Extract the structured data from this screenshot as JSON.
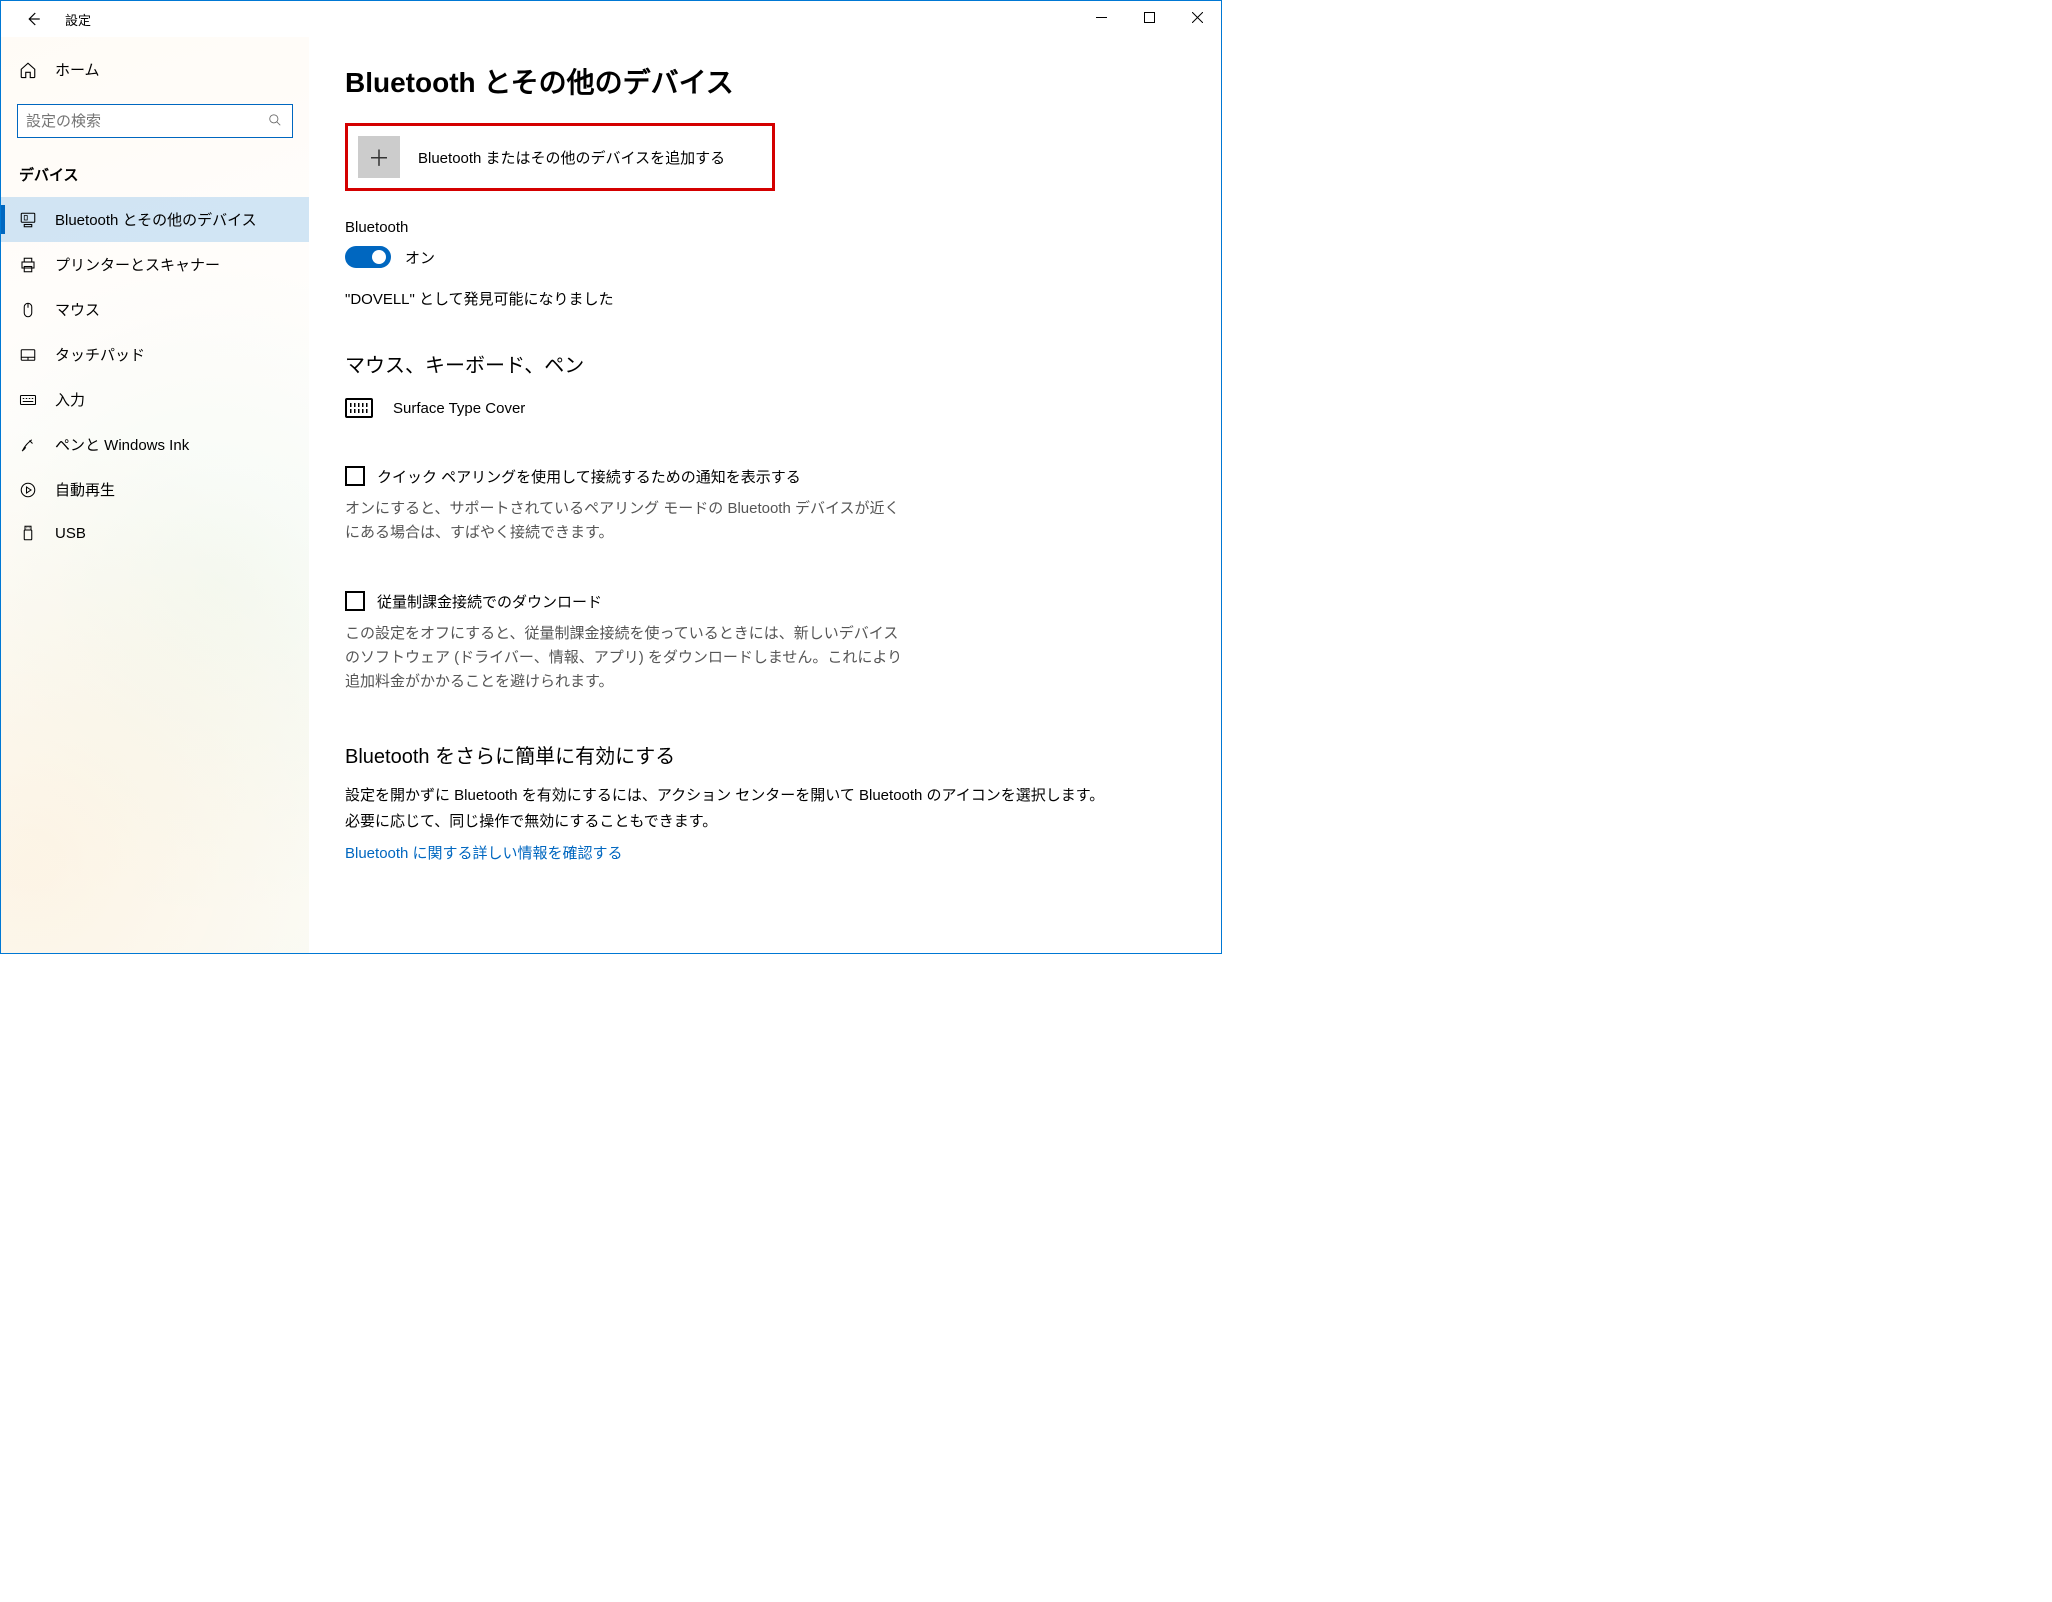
{
  "window": {
    "title": "設定"
  },
  "sidebar": {
    "home": "ホーム",
    "searchPlaceholder": "設定の検索",
    "category": "デバイス",
    "items": [
      {
        "label": "Bluetooth とその他のデバイス",
        "icon": "device-icon",
        "active": true
      },
      {
        "label": "プリンターとスキャナー",
        "icon": "printer-icon",
        "active": false
      },
      {
        "label": "マウス",
        "icon": "mouse-icon",
        "active": false
      },
      {
        "label": "タッチパッド",
        "icon": "touchpad-icon",
        "active": false
      },
      {
        "label": "入力",
        "icon": "keyboard-icon",
        "active": false
      },
      {
        "label": "ペンと Windows Ink",
        "icon": "pen-icon",
        "active": false
      },
      {
        "label": "自動再生",
        "icon": "autoplay-icon",
        "active": false
      },
      {
        "label": "USB",
        "icon": "usb-icon",
        "active": false
      }
    ]
  },
  "main": {
    "title": "Bluetooth とその他のデバイス",
    "addDevice": "Bluetooth またはその他のデバイスを追加する",
    "bluetoothLabel": "Bluetooth",
    "toggleState": "オン",
    "discoverable": "\"DOVELL\" として発見可能になりました",
    "groupTitle": "マウス、キーボード、ペン",
    "device0": "Surface Type Cover",
    "quickPair": {
      "checkLabel": "クイック ペアリングを使用して接続するための通知を表示する",
      "desc": "オンにすると、サポートされているペアリング モードの Bluetooth デバイスが近くにある場合は、すばやく接続できます。"
    },
    "metered": {
      "checkLabel": "従量制課金接続でのダウンロード",
      "desc": "この設定をオフにすると、従量制課金接続を使っているときには、新しいデバイスのソフトウェア (ドライバー、情報、アプリ) をダウンロードしません。これにより追加料金がかかることを避けられます。"
    },
    "more": {
      "title": "Bluetooth をさらに簡単に有効にする",
      "desc": "設定を開かずに Bluetooth を有効にするには、アクション センターを開いて Bluetooth のアイコンを選択します。必要に応じて、同じ操作で無効にすることもできます。",
      "link": "Bluetooth に関する詳しい情報を確認する"
    }
  }
}
